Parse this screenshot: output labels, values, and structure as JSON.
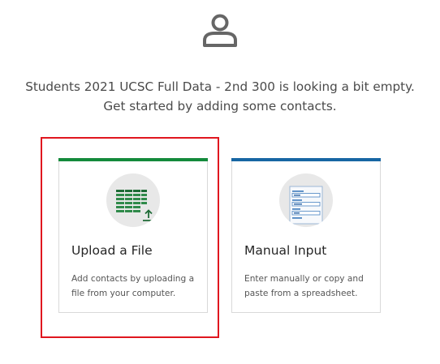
{
  "empty_state": {
    "message_line1": "Students 2021 UCSC Full Data - 2nd 300 is looking a bit empty.",
    "message_line2": "Get started by adding some contacts."
  },
  "cards": {
    "upload": {
      "title": "Upload a File",
      "description_line1": "Add contacts by uploading a",
      "description_line2": "file from your computer.",
      "accent_color": "#148a3c",
      "icon": "spreadsheet-upload-icon"
    },
    "manual": {
      "title": "Manual Input",
      "description_line1": "Enter manually or copy and",
      "description_line2": "paste from a spreadsheet.",
      "accent_color": "#1766a3",
      "icon": "form-input-icon"
    }
  },
  "colors": {
    "highlight_border": "#e0161f",
    "icon_gray": "#666666"
  }
}
